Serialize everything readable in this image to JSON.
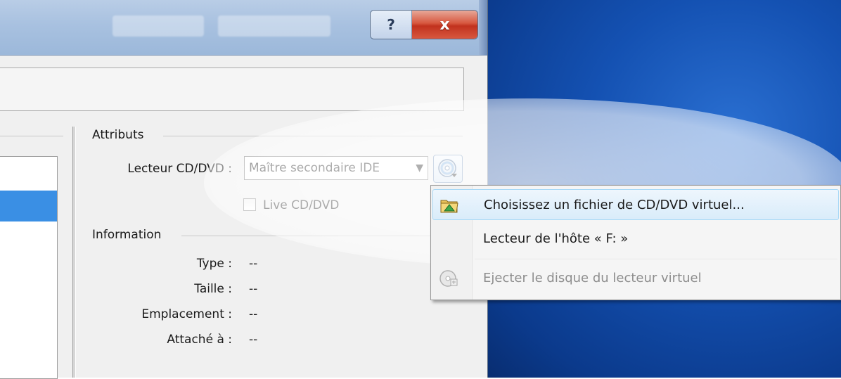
{
  "window": {
    "help_label": "?",
    "close_label": "x"
  },
  "attributes": {
    "title": "Attributs",
    "drive_label": "Lecteur CD/DVD :",
    "drive_value": "Maître secondaire IDE",
    "live_label": "Live CD/DVD",
    "live_checked": false
  },
  "information": {
    "title": "Information",
    "rows": [
      {
        "label": "Type :",
        "value": "--"
      },
      {
        "label": "Taille :",
        "value": "--"
      },
      {
        "label": "Emplacement :",
        "value": "--"
      },
      {
        "label": "Attaché à :",
        "value": "--"
      }
    ]
  },
  "menu": {
    "items": [
      {
        "label": "Choisissez un fichier de CD/DVD virtuel...",
        "icon": "folder-icon",
        "state": "highlighted"
      },
      {
        "label": "Lecteur de l'hôte « F: »",
        "icon": "",
        "state": "normal"
      },
      {
        "label": "Ejecter le disque du lecteur virtuel",
        "icon": "eject-disc-icon",
        "state": "disabled"
      }
    ]
  },
  "colors": {
    "desktop": "#1451b2",
    "selection": "#3a8fe4",
    "close_button": "#c1321e"
  }
}
